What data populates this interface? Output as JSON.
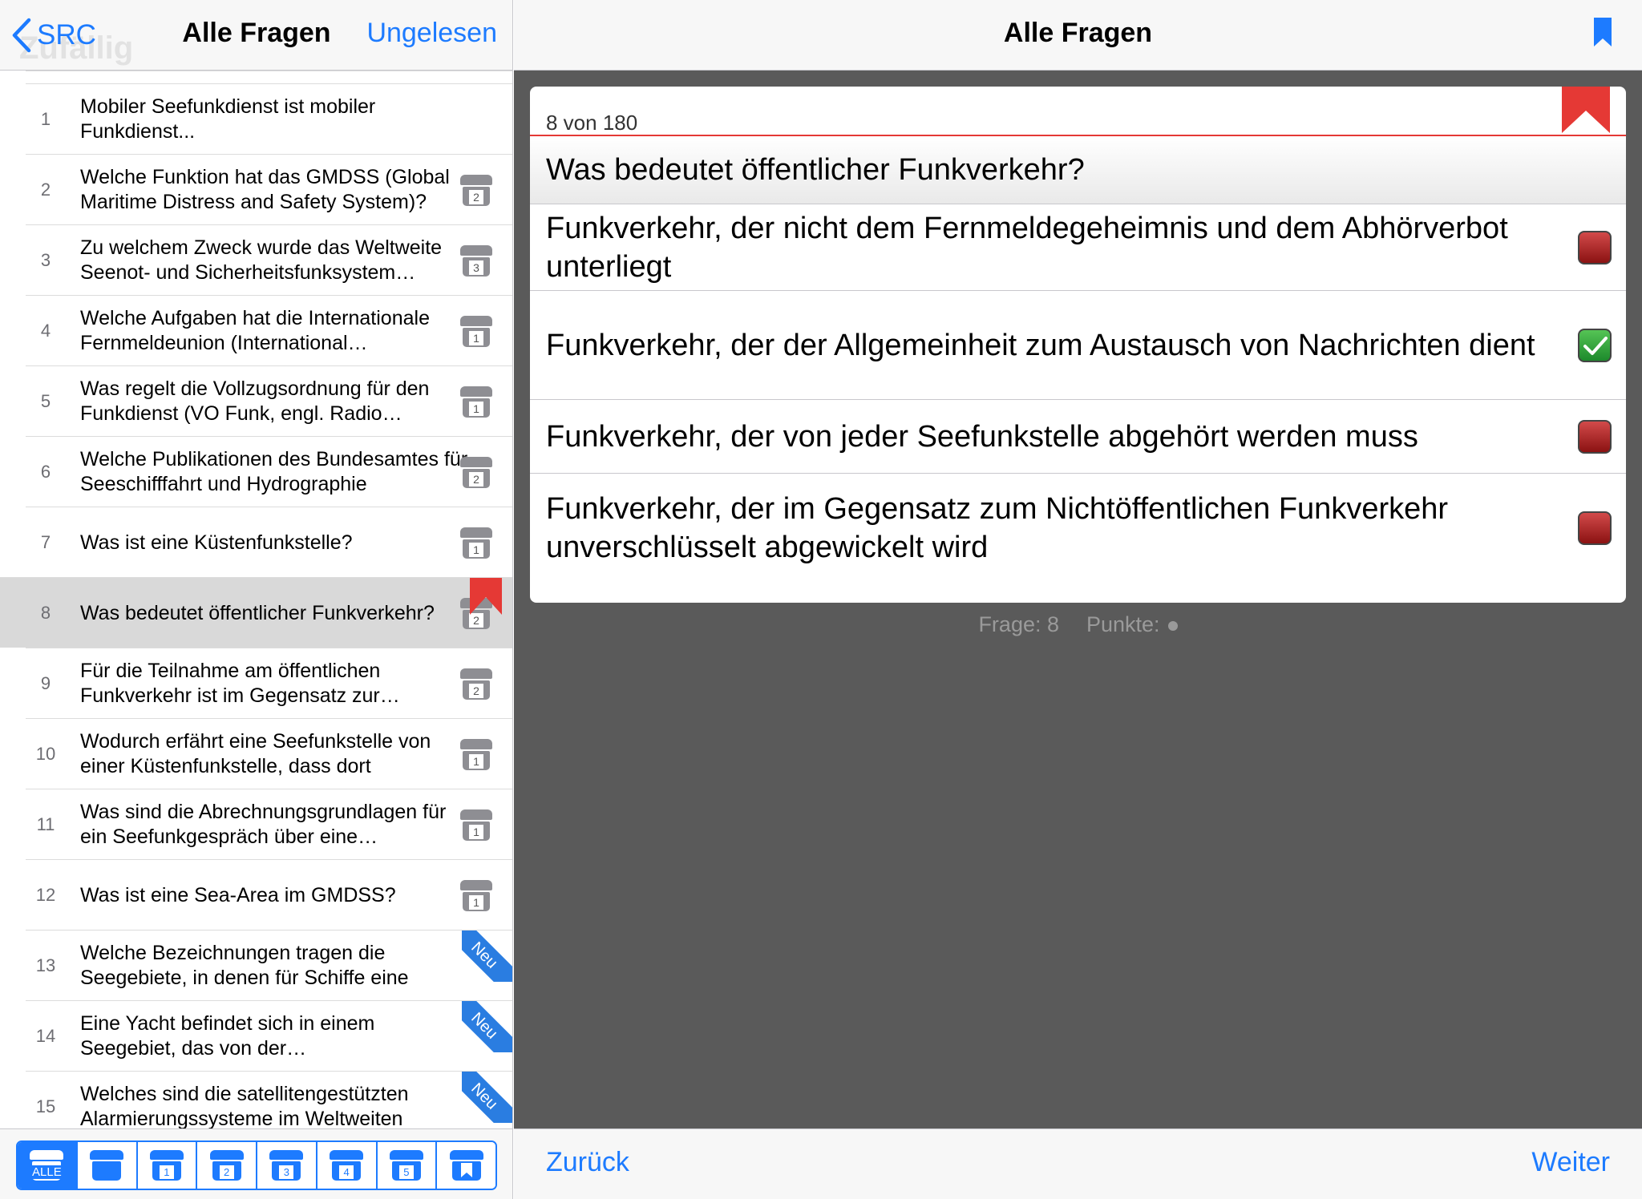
{
  "colors": {
    "accent": "#1d7bff",
    "flag": "#e53935",
    "neu_band": "#2a7de1",
    "detail_bg": "#5a5a5a",
    "wrong": "#a82424",
    "correct": "#2e9e3a"
  },
  "left_nav": {
    "back_label": "SRC",
    "ghost_label": "Zufällig",
    "title": "Alle Fragen",
    "unread_label": "Ungelesen"
  },
  "questions": [
    {
      "num": "1",
      "text": "Mobiler Seefunkdienst ist mobiler Funkdienst...",
      "box": ""
    },
    {
      "num": "2",
      "text": "Welche Funktion hat das GMDSS (Global Maritime Distress and Safety System)?",
      "box": "2"
    },
    {
      "num": "3",
      "text": "Zu welchem Zweck wurde das Weltweite Seenot- und Sicherheitsfunksystem geschaffen?",
      "box": "3"
    },
    {
      "num": "4",
      "text": "Welche Aufgaben hat die Internationale Fernmeldeunion (International Telecommunication Union)?",
      "box": "1"
    },
    {
      "num": "5",
      "text": "Was regelt die Vollzugsordnung für den Funkdienst (VO Funk, engl. Radio Regulations)?",
      "box": "1"
    },
    {
      "num": "6",
      "text": "Welche Publikationen des Bundesamtes für Seeschifffahrt und Hydrographie",
      "box": "2"
    },
    {
      "num": "7",
      "text": "Was ist eine Küstenfunkstelle?",
      "box": "1"
    },
    {
      "num": "8",
      "text": "Was bedeutet öffentlicher Funkverkehr?",
      "box": "2",
      "flagged": true
    },
    {
      "num": "9",
      "text": "Für die Teilnahme am öffentlichen Funkverkehr ist  im Gegensatz zur Teilnahme",
      "box": "2"
    },
    {
      "num": "10",
      "text": "Wodurch erfährt eine Seefunkstelle von einer Küstenfunkstelle, dass dort",
      "box": "1"
    },
    {
      "num": "11",
      "text": "Was sind die Abrechnungsgrundlagen für ein Seefunkgespräch über eine Küstenfunkstelle?",
      "box": "1"
    },
    {
      "num": "12",
      "text": "Was ist eine Sea-Area im GMDSS?",
      "box": "1"
    },
    {
      "num": "13",
      "text": "Welche Bezeichnungen tragen die Seegebiete, in denen für Schiffe eine",
      "new": "Neu"
    },
    {
      "num": "14",
      "text": "Eine Yacht befindet sich in einem Seegebiet, das von der Sprechfunkreichweite",
      "new": "Neu"
    },
    {
      "num": "15",
      "text": "Welches sind die satellitengestützten Alarmierungssysteme im Weltweiten",
      "new": "Neu"
    }
  ],
  "filter_tabs": [
    {
      "label": "ALLE",
      "icon": "all-box-icon",
      "active": true
    },
    {
      "label": "",
      "icon": "box-icon"
    },
    {
      "label": "1",
      "icon": "box-1-icon"
    },
    {
      "label": "2",
      "icon": "box-2-icon"
    },
    {
      "label": "3",
      "icon": "box-3-icon"
    },
    {
      "label": "4",
      "icon": "box-4-icon"
    },
    {
      "label": "5",
      "icon": "box-5-icon"
    },
    {
      "label": "",
      "icon": "bookmark-box-icon"
    }
  ],
  "detail": {
    "title": "Alle Fragen",
    "counter": "8 von 180",
    "question": "Was bedeutet öffentlicher Funkverkehr?",
    "answers": [
      {
        "text": "Funkverkehr, der nicht dem Fernmeldegeheimnis und dem Abhörverbot unterliegt",
        "state": "wrong"
      },
      {
        "text": "Funkverkehr, der der Allgemeinheit zum Austausch von Nachrichten dient",
        "state": "correct"
      },
      {
        "text": "Funkverkehr, der von jeder Seefunkstelle abgehört werden muss",
        "state": "wrong"
      },
      {
        "text": "Funkverkehr, der im Gegensatz zum Nichtöffentlichen Funkverkehr unverschlüsselt abgewickelt wird",
        "state": "wrong"
      }
    ],
    "status_frage": "Frage: 8",
    "status_punkte": "Punkte:"
  },
  "bottom": {
    "prev_label": "Zurück",
    "next_label": "Weiter"
  }
}
